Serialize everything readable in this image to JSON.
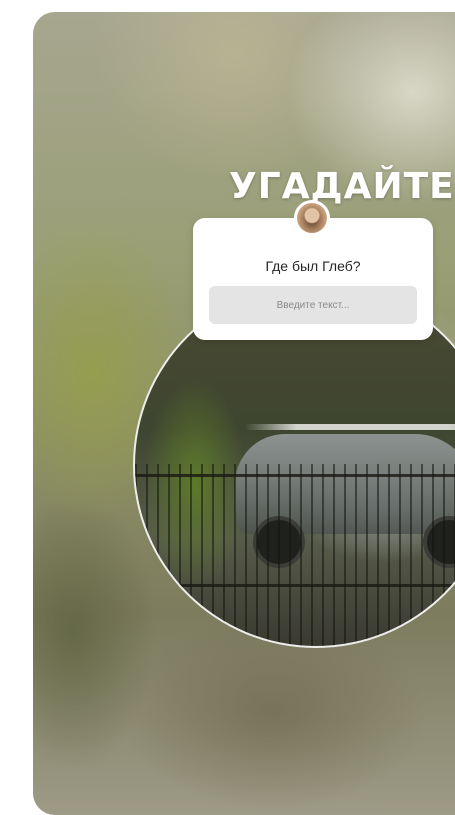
{
  "story": {
    "headline": "УГАДАЙТЕ",
    "question_sticker": {
      "question": "Где был Глеб?",
      "answer_placeholder": "Введите текст..."
    },
    "avatar_icon": "user-avatar-icon"
  },
  "colors": {
    "card_background": "#ffffff",
    "input_background": "#e4e4e4",
    "headline_text": "#ffffff",
    "question_text": "#262626"
  }
}
